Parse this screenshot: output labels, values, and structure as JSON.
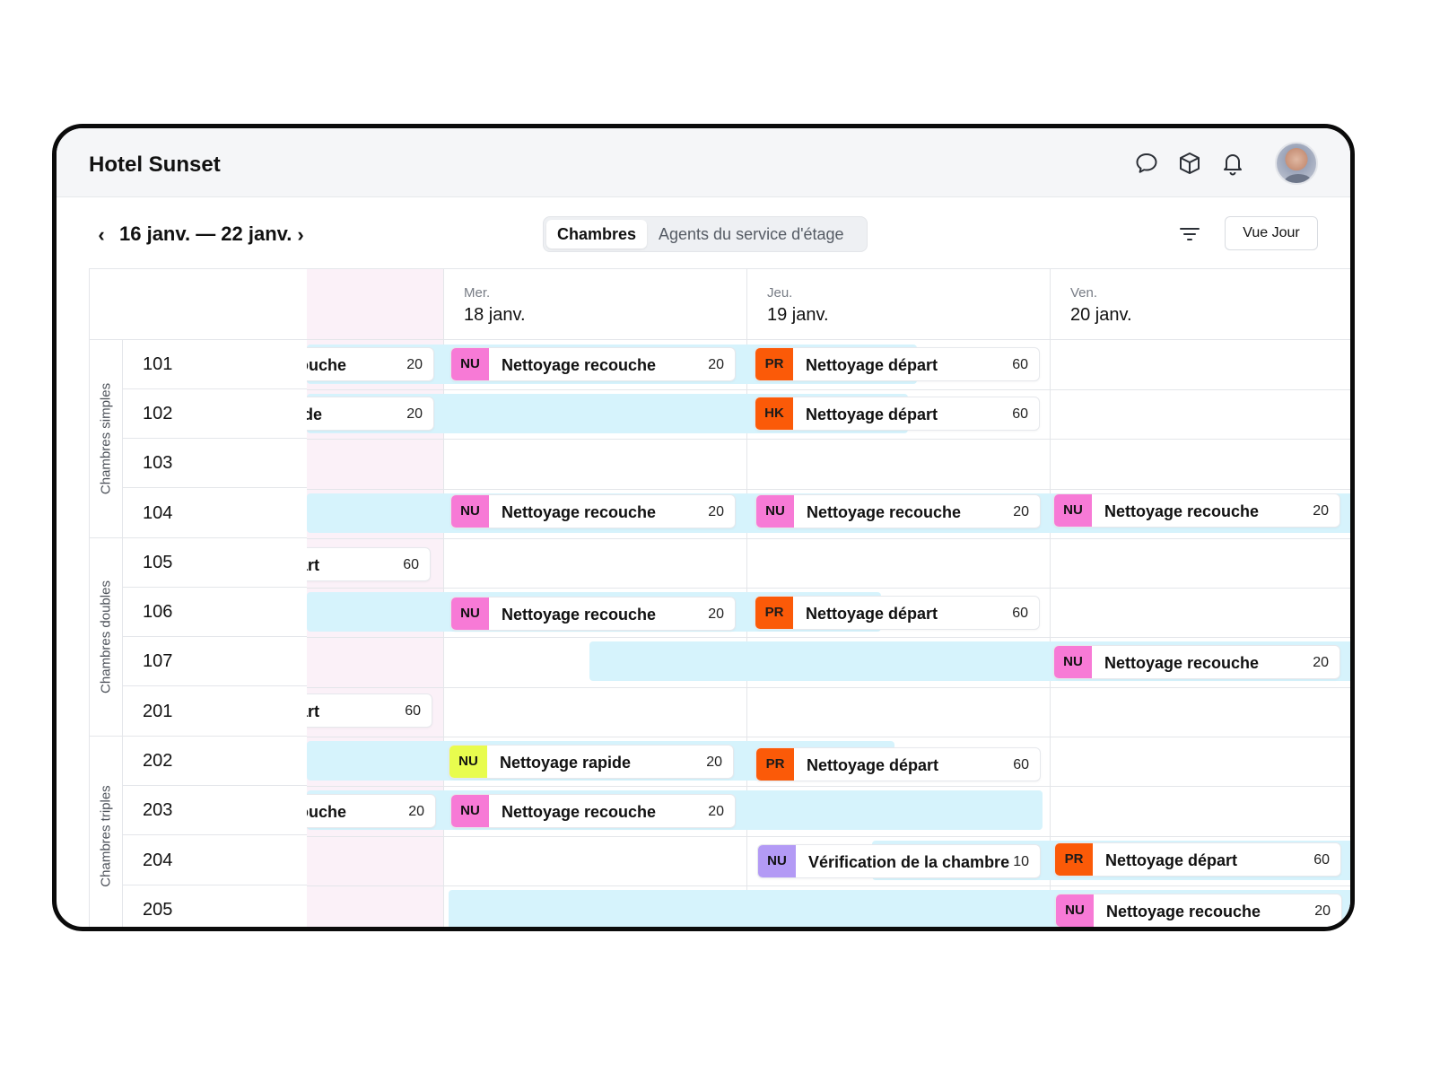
{
  "app": {
    "title": "Hotel Sunset"
  },
  "header_icons": [
    "chat-icon",
    "box-icon",
    "bell-icon"
  ],
  "toolbar": {
    "date_range": "16 janv. — 22 janv.",
    "tabs": [
      {
        "label": "Chambres",
        "active": true
      },
      {
        "label": "Agents du service d'étage",
        "active": false
      }
    ],
    "view_button": "Vue Jour"
  },
  "days": [
    {
      "name": "",
      "date": ""
    },
    {
      "name": "Mer.",
      "date": "18 janv."
    },
    {
      "name": "Jeu.",
      "date": "19 janv."
    },
    {
      "name": "Ven.",
      "date": "20 janv."
    }
  ],
  "groups": [
    {
      "label": "Chambres simples",
      "rooms": [
        "101",
        "102",
        "103",
        "104"
      ]
    },
    {
      "label": "Chambres doubles",
      "rooms": [
        "105",
        "106",
        "107",
        "201"
      ]
    },
    {
      "label": "Chambres triples",
      "rooms": [
        "202",
        "203",
        "204",
        "205"
      ]
    }
  ],
  "tasks": {
    "t1": {
      "badge": "",
      "label": "ouche",
      "duration": "20"
    },
    "t2": {
      "badge": "NU",
      "label": "Nettoyage recouche",
      "duration": "20"
    },
    "t3": {
      "badge": "PR",
      "label": "Nettoyage départ",
      "duration": "60"
    },
    "t4": {
      "badge": "",
      "label": "ide",
      "duration": "20"
    },
    "t5": {
      "badge": "HK",
      "label": "Nettoyage départ",
      "duration": "60"
    },
    "t6": {
      "badge": "NU",
      "label": "Nettoyage recouche",
      "duration": "20"
    },
    "t7": {
      "badge": "NU",
      "label": "Nettoyage recouche",
      "duration": "20"
    },
    "t8": {
      "badge": "NU",
      "label": "Nettoyage recouche",
      "duration": "20"
    },
    "t9": {
      "badge": "",
      "label": "art",
      "duration": "60"
    },
    "t10": {
      "badge": "NU",
      "label": "Nettoyage recouche",
      "duration": "20"
    },
    "t11": {
      "badge": "PR",
      "label": "Nettoyage départ",
      "duration": "60"
    },
    "t12": {
      "badge": "NU",
      "label": "Nettoyage recouche",
      "duration": "20"
    },
    "t13": {
      "badge": "",
      "label": "art",
      "duration": "60"
    },
    "t14": {
      "badge": "NU",
      "label": "Nettoyage rapide",
      "duration": "20"
    },
    "t15": {
      "badge": "PR",
      "label": "Nettoyage départ",
      "duration": "60"
    },
    "t16": {
      "badge": "",
      "label": "ouche",
      "duration": "20"
    },
    "t17": {
      "badge": "NU",
      "label": "Nettoyage recouche",
      "duration": "20"
    },
    "t18": {
      "badge": "NU",
      "label": "Vérification de la chambre",
      "duration": "10"
    },
    "t19": {
      "badge": "PR",
      "label": "Nettoyage départ",
      "duration": "60"
    },
    "t20": {
      "badge": "NU",
      "label": "Nettoyage recouche",
      "duration": "20"
    }
  },
  "colors": {
    "stay": "#d6f3fc",
    "badge_nu": "#f77ad6",
    "badge_pr": "#fb5a08",
    "badge_nu_rapide": "#e8fc4e",
    "badge_nu_verif": "#b39af5",
    "weekend": "#fbf1f8"
  }
}
